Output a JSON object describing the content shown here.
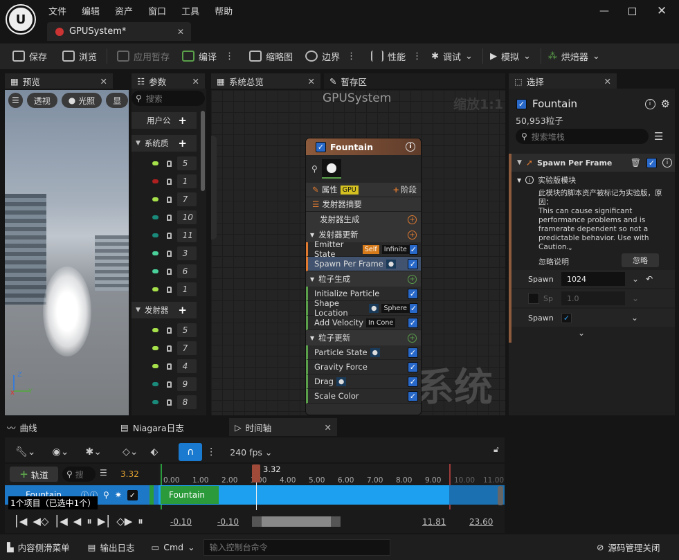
{
  "app": {
    "menu": [
      "文件",
      "编辑",
      "资产",
      "窗口",
      "工具",
      "帮助"
    ],
    "doc_tab": "GPUSystem*"
  },
  "toolbar": {
    "save": "保存",
    "browse": "浏览",
    "apply_pending": "应用暂存",
    "compile": "编译",
    "thumbnail": "缩略图",
    "bounds": "边界",
    "performance": "性能",
    "debug": "调试",
    "simulate": "模拟",
    "baker": "烘焙器"
  },
  "preview": {
    "tab": "预览",
    "perspective": "透视",
    "lighting": "光照",
    "show": "显"
  },
  "params": {
    "tab": "参数",
    "search_placeholder": "搜索",
    "user": "用户公",
    "system": "系统质",
    "emitter": "发射器",
    "system_values": [
      {
        "value": "5",
        "color": "#a6e04a"
      },
      {
        "value": "1",
        "color": "#b02020"
      },
      {
        "value": "7",
        "color": "#a6e04a"
      },
      {
        "value": "10",
        "color": "#1a8a7a"
      },
      {
        "value": "11",
        "color": "#1a8a7a"
      },
      {
        "value": "3",
        "color": "#4ad09a"
      },
      {
        "value": "6",
        "color": "#4ad09a"
      },
      {
        "value": "1",
        "color": "#a6e04a"
      }
    ],
    "emitter_values": [
      {
        "value": "5",
        "color": "#a6e04a"
      },
      {
        "value": "7",
        "color": "#a6e04a"
      },
      {
        "value": "4",
        "color": "#a6e04a"
      },
      {
        "value": "9",
        "color": "#1a8a7a"
      },
      {
        "value": "8",
        "color": "#1a8a7a"
      }
    ]
  },
  "graph": {
    "overview_tab": "系统总览",
    "scratch_tab": "暂存区",
    "title": "GPUSystem",
    "zoom": "缩放1:1",
    "watermark": "系统",
    "node": {
      "name": "Fountain",
      "props": "属性",
      "gpu": "GPU",
      "stage": "阶段",
      "summary": "发射器摘要",
      "spawn_section": "发射器生成",
      "update_section": "发射器更新",
      "emitter_state": "Emitter State",
      "self_tag": "Self",
      "infinite_tag": "Infinite",
      "spawn_per_frame": "Spawn Per Frame",
      "particle_spawn": "粒子生成",
      "init_particle": "Initialize Particle",
      "shape_location": "Shape Location",
      "sphere_tag": "Sphere",
      "add_velocity": "Add Velocity",
      "in_cone_tag": "In Cone",
      "particle_update": "粒子更新",
      "particle_state": "Particle State",
      "gravity": "Gravity Force",
      "drag": "Drag",
      "scale_color": "Scale Color"
    }
  },
  "selection": {
    "tab": "选择",
    "name": "Fountain",
    "count": "50,953粒子",
    "search_placeholder": "搜索堆栈",
    "module": "Spawn Per Frame",
    "experimental": "实验版模块",
    "message": "此模块的脚本资产被标记为实验版，原因：\nThis can cause significant performance problems and is framerate dependent so not a predictable behavior. Use with Caution.。",
    "ignore_label": "忽略说明",
    "ignore_btn": "忽略",
    "spawn1_label": "Spawn",
    "spawn1_value": "1024",
    "sp_label": "Sp",
    "sp_value": "1.0",
    "spawn3_label": "Spawn"
  },
  "bottom": {
    "curves_tab": "曲线",
    "log_tab": "Niagara日志",
    "timeline_tab": "时间轴",
    "fps": "240 fps",
    "track_btn": "轨道",
    "search_placeholder": "搜",
    "current_time": "3.32",
    "playhead_label": "3.32",
    "ticks": [
      "0.00",
      "1.00",
      "2.00",
      "3.00",
      "4.00",
      "5.00",
      "6.00",
      "7.00",
      "8.00",
      "9.00",
      "10.00",
      "11.00"
    ],
    "track_name": "Fountain",
    "clip_name": "Fountain",
    "items_info": "1个项目（已选中1个）",
    "range_start": "-0.10",
    "view_start": "-0.10",
    "view_end": "11.81",
    "range_end": "23.60"
  },
  "status": {
    "drawer": "内容侧滑菜单",
    "output_log": "输出日志",
    "cmd": "Cmd",
    "cmd_placeholder": "输入控制台命令",
    "source_control": "源码管理关闭"
  },
  "colors": {
    "accent_blue": "#1ea0f0",
    "selection_blue": "#2868c8",
    "node_header": "#8c5a3c",
    "orange": "#e07a30"
  }
}
